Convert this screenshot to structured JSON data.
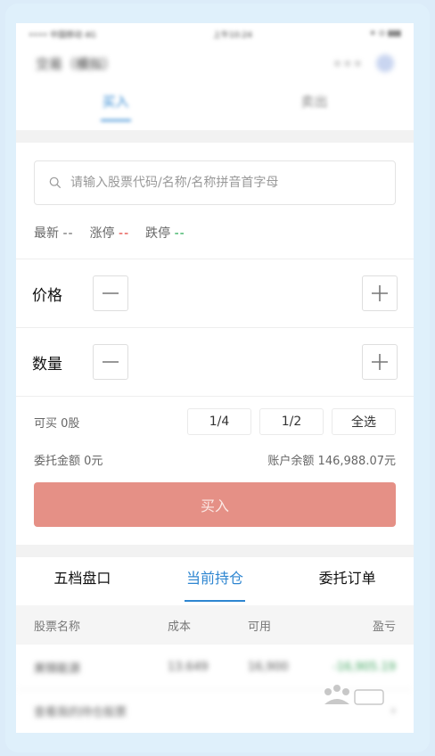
{
  "status_bar": {
    "carrier": "•••• 中国移动  4G",
    "time": "上午10:24",
    "battery": "✦ ⊙ ▮▮▮"
  },
  "nav": {
    "title": "交易（模拟）",
    "more": "•••"
  },
  "top_tabs": {
    "buy": "买入",
    "sell": "卖出"
  },
  "search": {
    "placeholder": "请输入股票代码/名称/名称拼音首字母"
  },
  "quotes": {
    "latest_label": "最新",
    "latest_value": "--",
    "limit_up_label": "涨停",
    "limit_up_value": "--",
    "limit_down_label": "跌停",
    "limit_down_value": "--"
  },
  "price": {
    "label": "价格"
  },
  "quantity": {
    "label": "数量"
  },
  "can_buy": "可买 0股",
  "fractions": [
    "1/4",
    "1/2",
    "全选"
  ],
  "order_amount": "委托金额 0元",
  "account_balance": "账户余额 146,988.07元",
  "buy_button": "买入",
  "bottom_tabs": {
    "book": "五档盘口",
    "holdings": "当前持仓",
    "orders": "委托订单"
  },
  "table": {
    "headers": [
      "股票名称",
      "成本",
      "可用",
      "盈亏"
    ],
    "rows": [
      [
        "美锦能源",
        "13.649",
        "16,900",
        "-16,905.19"
      ]
    ],
    "footer": "查看我的持仓股票"
  },
  "colors": {
    "accent": "#2e86d1",
    "buy": "#e59086",
    "up": "#e0332c",
    "down": "#19a64a"
  }
}
